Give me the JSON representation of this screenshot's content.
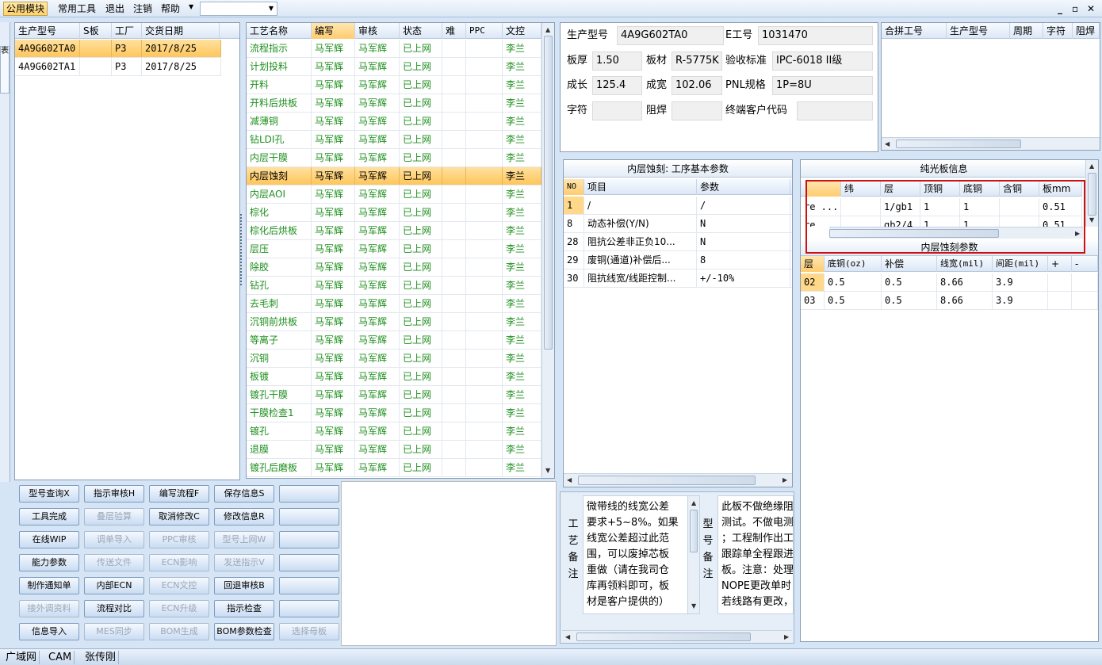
{
  "menubar": {
    "items": [
      "公用模块",
      "常用工具",
      "退出",
      "注销",
      "帮助"
    ],
    "combo_value": "",
    "window_controls": [
      "_",
      "▫",
      "✕"
    ]
  },
  "left_edge_tab": "表",
  "orders": {
    "headers": [
      "生产型号",
      "S板",
      "工厂",
      "交货日期"
    ],
    "rows": [
      {
        "model": "4A9G602TA0",
        "s": "",
        "factory": "P3",
        "date": "2017/8/25"
      },
      {
        "model": "4A9G602TA1",
        "s": "",
        "factory": "P3",
        "date": "2017/8/25"
      }
    ]
  },
  "process": {
    "headers": [
      "工艺名称",
      "编写",
      "审核",
      "状态",
      "难",
      "PPC",
      "文控"
    ],
    "rows": [
      {
        "name": "流程指示",
        "writer": "马军辉",
        "reviewer": "马军辉",
        "status": "已上网",
        "doc": "李兰"
      },
      {
        "name": "计划投料",
        "writer": "马军辉",
        "reviewer": "马军辉",
        "status": "已上网",
        "doc": "李兰"
      },
      {
        "name": "开料",
        "writer": "马军辉",
        "reviewer": "马军辉",
        "status": "已上网",
        "doc": "李兰"
      },
      {
        "name": "开料后烘板",
        "writer": "马军辉",
        "reviewer": "马军辉",
        "status": "已上网",
        "doc": "李兰"
      },
      {
        "name": "减薄铜",
        "writer": "马军辉",
        "reviewer": "马军辉",
        "status": "已上网",
        "doc": "李兰"
      },
      {
        "name": "钻LDI孔",
        "writer": "马军辉",
        "reviewer": "马军辉",
        "status": "已上网",
        "doc": "李兰"
      },
      {
        "name": "内层干膜",
        "writer": "马军辉",
        "reviewer": "马军辉",
        "status": "已上网",
        "doc": "李兰"
      },
      {
        "name": "内层蚀刻",
        "writer": "马军辉",
        "reviewer": "马军辉",
        "status": "已上网",
        "doc": "李兰"
      },
      {
        "name": "内层AOI",
        "writer": "马军辉",
        "reviewer": "马军辉",
        "status": "已上网",
        "doc": "李兰"
      },
      {
        "name": "棕化",
        "writer": "马军辉",
        "reviewer": "马军辉",
        "status": "已上网",
        "doc": "李兰"
      },
      {
        "name": "棕化后烘板",
        "writer": "马军辉",
        "reviewer": "马军辉",
        "status": "已上网",
        "doc": "李兰"
      },
      {
        "name": "层压",
        "writer": "马军辉",
        "reviewer": "马军辉",
        "status": "已上网",
        "doc": "李兰"
      },
      {
        "name": "除胶",
        "writer": "马军辉",
        "reviewer": "马军辉",
        "status": "已上网",
        "doc": "李兰"
      },
      {
        "name": "钻孔",
        "writer": "马军辉",
        "reviewer": "马军辉",
        "status": "已上网",
        "doc": "李兰"
      },
      {
        "name": "去毛刺",
        "writer": "马军辉",
        "reviewer": "马军辉",
        "status": "已上网",
        "doc": "李兰"
      },
      {
        "name": "沉铜前烘板",
        "writer": "马军辉",
        "reviewer": "马军辉",
        "status": "已上网",
        "doc": "李兰"
      },
      {
        "name": "等离子",
        "writer": "马军辉",
        "reviewer": "马军辉",
        "status": "已上网",
        "doc": "李兰"
      },
      {
        "name": "沉铜",
        "writer": "马军辉",
        "reviewer": "马军辉",
        "status": "已上网",
        "doc": "李兰"
      },
      {
        "name": "板镀",
        "writer": "马军辉",
        "reviewer": "马军辉",
        "status": "已上网",
        "doc": "李兰"
      },
      {
        "name": "镀孔干膜",
        "writer": "马军辉",
        "reviewer": "马军辉",
        "status": "已上网",
        "doc": "李兰"
      },
      {
        "name": "干膜检查1",
        "writer": "马军辉",
        "reviewer": "马军辉",
        "status": "已上网",
        "doc": "李兰"
      },
      {
        "name": "镀孔",
        "writer": "马军辉",
        "reviewer": "马军辉",
        "status": "已上网",
        "doc": "李兰"
      },
      {
        "name": "退膜",
        "writer": "马军辉",
        "reviewer": "马军辉",
        "status": "已上网",
        "doc": "李兰"
      },
      {
        "name": "镀孔后磨板",
        "writer": "马军辉",
        "reviewer": "马军辉",
        "status": "已上网",
        "doc": "李兰"
      }
    ]
  },
  "buttons": [
    [
      "型号查询X",
      "指示审核H",
      "编写流程F",
      "保存信息S",
      ""
    ],
    [
      "工具完成",
      "叠层验算",
      "取消修改C",
      "修改信息R",
      ""
    ],
    [
      "在线WIP",
      "调单导入",
      "PPC审核",
      "型号上网W",
      ""
    ],
    [
      "能力参数",
      "传送文件",
      "ECN影响",
      "发送指示V",
      ""
    ],
    [
      "制作通知单",
      "内部ECN",
      "ECN文控",
      "回退审核B",
      ""
    ],
    [
      "接外调资料",
      "流程对比",
      "ECN升级",
      "指示检查",
      ""
    ],
    [
      "信息导入",
      "MES同步",
      "BOM生成",
      "BOM参数检查",
      "选择母板"
    ]
  ],
  "product_info": {
    "model_label": "生产型号",
    "model_value": "4A9G602TA0",
    "e_label": "E工号",
    "e_value": "1031470",
    "thickness_label": "板厚",
    "thickness_value": "1.50",
    "material_label": "板材",
    "material_value": "R-5775K",
    "standard_label": "验收标准",
    "standard_value": "IPC-6018 II级",
    "length_label": "成长",
    "length_value": "125.4",
    "width_label": "成宽",
    "width_value": "102.06",
    "pnl_label": "PNL规格",
    "pnl_value": "1P=8U",
    "char_label": "字符",
    "char_value": "",
    "mask_label": "阻焊",
    "mask_value": "",
    "customer_label": "终端客户代码",
    "customer_value": ""
  },
  "combined": {
    "headers": [
      "合拼工号",
      "生产型号",
      "周期",
      "字符",
      "阻焊"
    ]
  },
  "etch_params": {
    "title": "内层蚀刻: 工序基本参数",
    "headers": [
      "NO",
      "项目",
      "参数"
    ],
    "rows": [
      {
        "no": "1",
        "item": "/",
        "value": "/"
      },
      {
        "no": "8",
        "item": "动态补偿(Y/N)",
        "value": "N"
      },
      {
        "no": "28",
        "item": "阻抗公差非正负10...",
        "value": "N"
      },
      {
        "no": "29",
        "item": "废铜(通道)补偿后...",
        "value": "8"
      },
      {
        "no": "30",
        "item": "阻抗线宽/线距控制...",
        "value": "+/-10%"
      }
    ]
  },
  "bare_board": {
    "title": "纯光板信息",
    "headers": [
      "",
      "纬",
      "层",
      "顶铜",
      "底铜",
      "含铜",
      "板mm"
    ],
    "rows": [
      [
        "re ...",
        "",
        "1/gb1",
        "1",
        "1",
        "",
        "0.51"
      ],
      [
        "re",
        "",
        "gb2/4",
        "1",
        "1",
        "",
        "0.51"
      ]
    ]
  },
  "etch_layer": {
    "title": "内层蚀刻参数",
    "headers": [
      "层",
      "底铜(oz)",
      "补偿",
      "线宽(mil)",
      "间距(mil)",
      "+",
      "-"
    ],
    "rows": [
      [
        "02",
        "0.5",
        "0.5",
        "8.66",
        "3.9",
        "",
        ""
      ],
      [
        "03",
        "0.5",
        "0.5",
        "8.66",
        "3.9",
        "",
        ""
      ]
    ]
  },
  "notes": {
    "process_label": [
      "工",
      "艺",
      "备",
      "注"
    ],
    "process_lines": [
      "微带线的线宽公差",
      "要求+5~8%。如果",
      "线宽公差超过此范",
      "围，可以废掉芯板",
      "重做（请在我司仓",
      "库再领料即可，板",
      "材是客户提供的）"
    ],
    "model_label": [
      "型",
      "号",
      "备",
      "注"
    ],
    "model_lines": [
      "此板不做绝缘阻",
      "测试。不做电测",
      "；工程制作出工",
      "跟踪单全程跟进",
      "板。注意：处理",
      "NOPE更改单时",
      "若线路有更改，"
    ]
  },
  "status": [
    "广域网",
    "CAM",
    "张传刚"
  ],
  "colors": {
    "selection": "#ffc65a",
    "green_text": "#1f8f1f",
    "highlight_box": "#d01010"
  }
}
